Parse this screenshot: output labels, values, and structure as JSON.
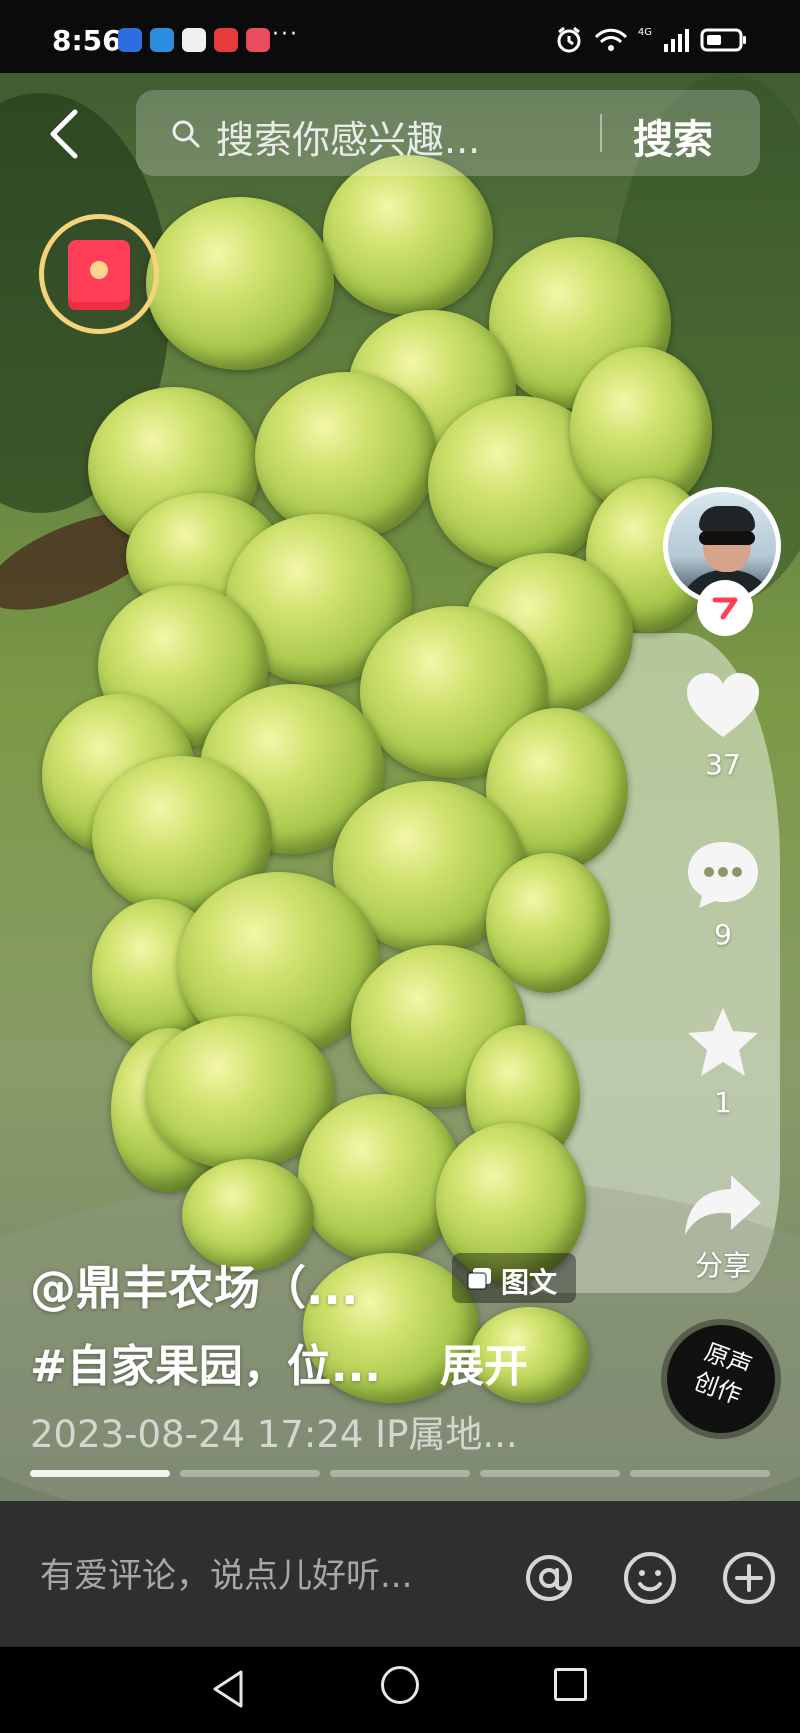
{
  "status_bar": {
    "time": "8:56",
    "more": "···",
    "network": "4G"
  },
  "search": {
    "placeholder": "搜索你感兴趣...",
    "button_label": "搜索"
  },
  "post": {
    "author": "@鼎丰农场（...",
    "badge": "图文",
    "tags": "#自家果园，位...",
    "expand": "展开",
    "meta": "2023-08-24 17:24  IP属地..."
  },
  "actions": {
    "likes": "37",
    "comments": "9",
    "collects": "1",
    "share_label": "分享"
  },
  "music": {
    "disc_text": "原声 创作"
  },
  "comment_bar": {
    "placeholder": "有爱评论，说点儿好听..."
  },
  "progress": {
    "total_segments": 5,
    "active_segment": 1
  },
  "colors": {
    "accent_red": "#ff3e58",
    "ring_gold": "#f4d37a",
    "comment_bar_bg": "#2f2f2f"
  }
}
